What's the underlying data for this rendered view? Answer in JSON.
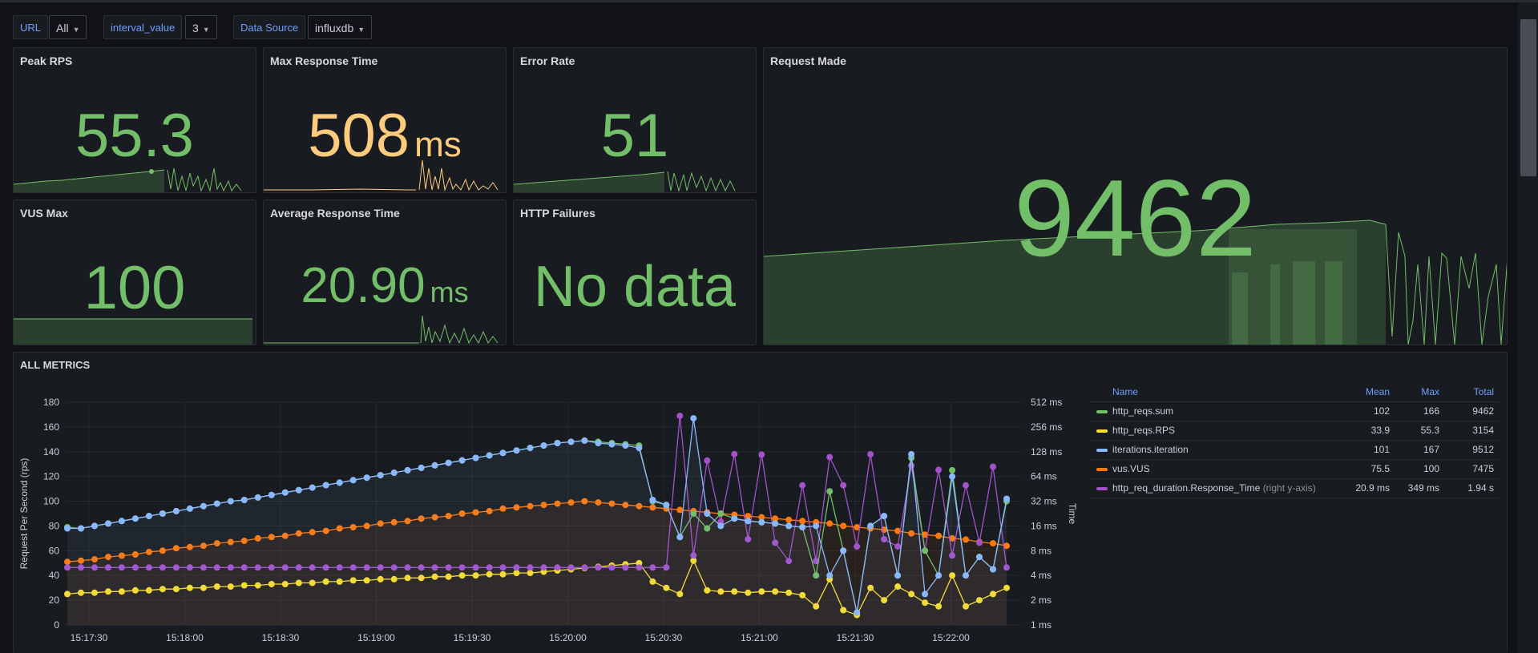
{
  "variables": [
    {
      "label": "URL",
      "value": "All"
    },
    {
      "label": "interval_value",
      "value": "3"
    },
    {
      "label": "Data Source",
      "value": "influxdb"
    }
  ],
  "stats": {
    "peak_rps": {
      "title": "Peak RPS",
      "value": "55.3"
    },
    "max_response": {
      "title": "Max Response Time",
      "value": "508",
      "unit": "ms"
    },
    "error_rate": {
      "title": "Error Rate",
      "value": "51"
    },
    "request_made": {
      "title": "Request Made",
      "value": "9462"
    },
    "vus_max": {
      "title": "VUS Max",
      "value": "100"
    },
    "avg_response": {
      "title": "Average Response Time",
      "value": "20.90",
      "unit": "ms"
    },
    "http_failures": {
      "title": "HTTP Failures",
      "value": "No data"
    }
  },
  "colors": {
    "green": "#73bf69",
    "yellow": "#fade2a",
    "blue": "#8ab8ff",
    "orange": "#ff780a",
    "purple": "#a352cc",
    "max_response_value": "#ffcb7d"
  },
  "all_metrics": {
    "title": "ALL METRICS",
    "ylabel_left": "Request Per Second (rps)",
    "ylabel_right": "Time",
    "legend": {
      "headers": {
        "name": "Name",
        "mean": "Mean",
        "max": "Max",
        "total": "Total"
      },
      "rows": [
        {
          "name": "http_reqs.sum",
          "note": "",
          "mean": "102",
          "max": "166",
          "total": "9462",
          "color": "#73bf69"
        },
        {
          "name": "http_reqs.RPS",
          "note": "",
          "mean": "33.9",
          "max": "55.3",
          "total": "3154",
          "color": "#fade2a"
        },
        {
          "name": "iterations.iteration",
          "note": "",
          "mean": "101",
          "max": "167",
          "total": "9512",
          "color": "#8ab8ff"
        },
        {
          "name": "vus.VUS",
          "note": "",
          "mean": "75.5",
          "max": "100",
          "total": "7475",
          "color": "#ff780a"
        },
        {
          "name": "http_req_duration.Response_Time",
          "note": "(right y-axis)",
          "mean": "20.9 ms",
          "max": "349 ms",
          "total": "1.94 s",
          "color": "#a352cc"
        }
      ]
    }
  },
  "chart_data": {
    "type": "line",
    "ylabel": "Request Per Second (rps)",
    "y2label": "Time",
    "ylim": [
      0,
      180
    ],
    "yticks": [
      "0",
      "20",
      "40",
      "60",
      "80",
      "100",
      "120",
      "140",
      "160",
      "180"
    ],
    "y2ticks": [
      "1 ms",
      "2 ms",
      "4 ms",
      "8 ms",
      "16 ms",
      "32 ms",
      "64 ms",
      "128 ms",
      "256 ms",
      "512 ms"
    ],
    "y2scale": "log2",
    "xticks": [
      "15:17:30",
      "15:18:00",
      "15:18:30",
      "15:19:00",
      "15:19:30",
      "15:20:00",
      "15:20:30",
      "15:21:00",
      "15:21:30",
      "15:22:00"
    ],
    "series": [
      {
        "name": "http_reqs.sum",
        "color": "#73bf69",
        "axis": "left",
        "values": [
          79,
          78,
          80,
          82,
          84,
          86,
          88,
          90,
          92,
          94,
          96,
          98,
          100,
          101,
          103,
          105,
          107,
          109,
          111,
          113,
          115,
          117,
          119,
          121,
          123,
          125,
          127,
          129,
          131,
          133,
          135,
          137,
          139,
          141,
          143,
          145,
          147,
          148,
          149,
          148,
          147,
          146,
          145,
          100,
          97,
          71,
          90,
          78,
          90,
          86,
          84,
          83,
          82,
          80,
          79,
          40,
          108,
          60,
          10,
          80,
          88,
          40,
          135,
          60,
          40,
          125,
          40,
          55,
          45,
          100
        ]
      },
      {
        "name": "http_reqs.RPS",
        "color": "#fade2a",
        "axis": "left",
        "values": [
          25,
          26,
          26,
          27,
          27,
          28,
          28,
          29,
          29,
          30,
          30,
          31,
          31,
          32,
          32,
          33,
          33,
          34,
          34,
          35,
          35,
          36,
          36,
          37,
          37,
          38,
          38,
          39,
          39,
          40,
          40,
          41,
          41,
          42,
          42,
          43,
          44,
          45,
          46,
          47,
          48,
          49,
          50,
          35,
          30,
          25,
          52,
          28,
          27,
          27,
          26,
          27,
          27,
          26,
          24,
          15,
          37,
          12,
          8,
          30,
          20,
          31,
          25,
          18,
          15,
          40,
          15,
          20,
          25,
          30
        ]
      },
      {
        "name": "iterations.iteration",
        "color": "#8ab8ff",
        "axis": "left",
        "values": [
          78,
          78,
          80,
          82,
          84,
          86,
          88,
          90,
          92,
          94,
          96,
          98,
          100,
          101,
          103,
          105,
          107,
          109,
          111,
          113,
          115,
          117,
          119,
          121,
          123,
          125,
          127,
          129,
          131,
          133,
          135,
          137,
          139,
          141,
          143,
          145,
          147,
          148,
          149,
          147,
          146,
          145,
          143,
          101,
          97,
          71,
          167,
          90,
          80,
          86,
          84,
          83,
          82,
          80,
          79,
          80,
          40,
          60,
          10,
          80,
          88,
          40,
          138,
          25,
          40,
          120,
          40,
          55,
          45,
          102
        ]
      },
      {
        "name": "vus.VUS",
        "color": "#ff780a",
        "axis": "left",
        "values": [
          51,
          52,
          53,
          55,
          56,
          57,
          59,
          60,
          62,
          63,
          64,
          66,
          67,
          68,
          70,
          71,
          72,
          74,
          75,
          76,
          78,
          79,
          80,
          82,
          83,
          84,
          86,
          87,
          88,
          90,
          91,
          92,
          94,
          95,
          96,
          97,
          98,
          99,
          100,
          99,
          98,
          97,
          96,
          95,
          94,
          93,
          92,
          91,
          90,
          89,
          88,
          87,
          86,
          85,
          84,
          83,
          82,
          80,
          79,
          78,
          77,
          76,
          74,
          73,
          72,
          70,
          69,
          67,
          66,
          64
        ]
      },
      {
        "name": "http_req_duration.Response_Time",
        "color": "#a352cc",
        "axis": "right",
        "unit": "ms",
        "values": [
          5,
          5,
          5,
          5,
          5,
          5,
          5,
          5,
          5,
          5,
          5,
          5,
          5,
          5,
          5,
          5,
          5,
          5,
          5,
          5,
          5,
          5,
          5,
          5,
          5,
          5,
          5,
          5,
          5,
          5,
          5,
          5,
          5,
          5,
          5,
          5,
          5,
          5,
          5,
          5,
          5,
          5,
          5,
          5,
          5,
          349,
          7,
          100,
          18,
          120,
          11,
          118,
          10,
          6,
          50,
          6,
          110,
          50,
          9,
          119,
          11,
          9,
          87,
          8,
          77,
          7,
          50,
          10,
          84,
          5
        ]
      }
    ]
  }
}
